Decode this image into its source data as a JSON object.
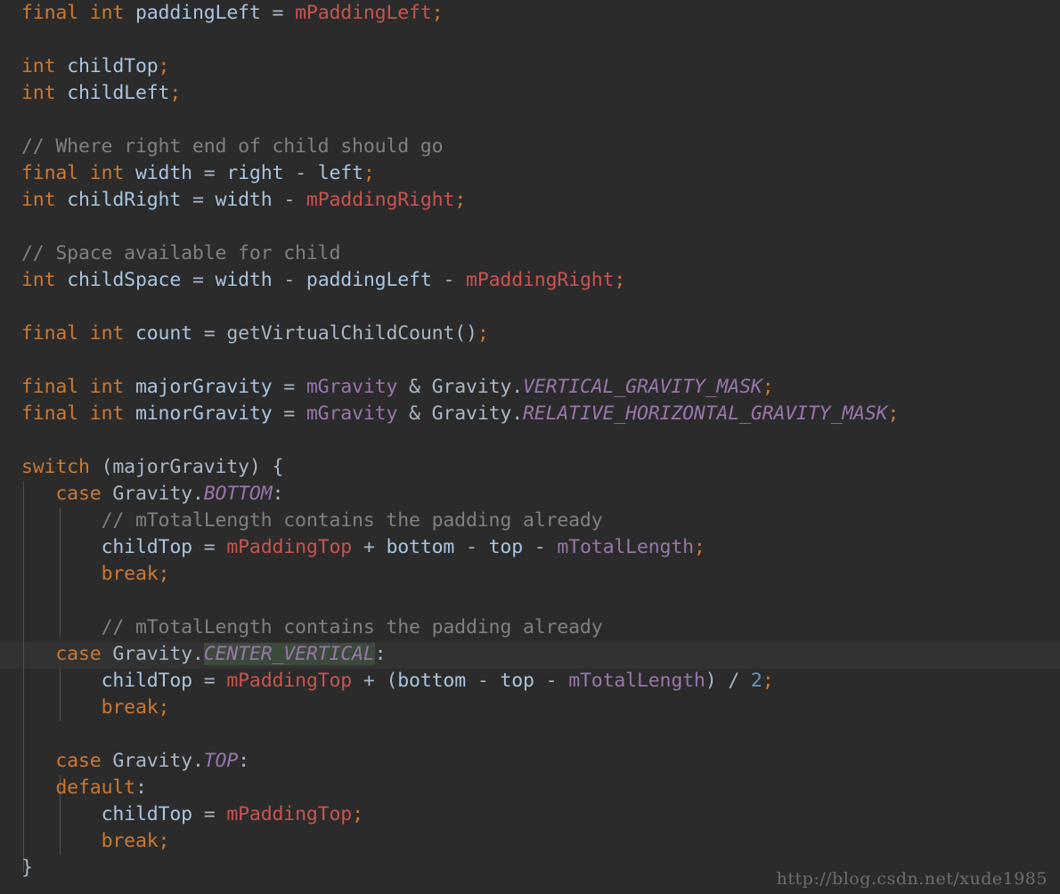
{
  "editor": {
    "language": "java",
    "theme": "darcula",
    "background_color": "#2b2b2b",
    "caret_line_color": "#323232",
    "font_size_px": 21.5,
    "line_height_px": 30,
    "caret_line_index": 24,
    "indent_guide_color": "#4f5052",
    "colors": {
      "keyword": "#cc7832",
      "identifier": "#a9b7c6",
      "local_variable": "#a9c5e0",
      "instance_field_red": "#c75450",
      "field_purple": "#9876aa",
      "static_constant": "#9876aa",
      "comment": "#808080",
      "number": "#6897bb",
      "punctuation": "#cc7832",
      "highlight_box": "#3c4a3c"
    }
  },
  "code_lines": [
    {
      "n": 1,
      "text": "final int paddingLeft = mPaddingLeft;"
    },
    {
      "n": 2,
      "text": ""
    },
    {
      "n": 3,
      "text": "int childTop;"
    },
    {
      "n": 4,
      "text": "int childLeft;"
    },
    {
      "n": 5,
      "text": ""
    },
    {
      "n": 6,
      "text": "// Where right end of child should go"
    },
    {
      "n": 7,
      "text": "final int width = right - left;"
    },
    {
      "n": 8,
      "text": "int childRight = width - mPaddingRight;"
    },
    {
      "n": 9,
      "text": ""
    },
    {
      "n": 10,
      "text": "// Space available for child"
    },
    {
      "n": 11,
      "text": "int childSpace = width - paddingLeft - mPaddingRight;"
    },
    {
      "n": 12,
      "text": ""
    },
    {
      "n": 13,
      "text": "final int count = getVirtualChildCount();"
    },
    {
      "n": 14,
      "text": ""
    },
    {
      "n": 15,
      "text": "final int majorGravity = mGravity & Gravity.VERTICAL_GRAVITY_MASK;"
    },
    {
      "n": 16,
      "text": "final int minorGravity = mGravity & Gravity.RELATIVE_HORIZONTAL_GRAVITY_MASK;"
    },
    {
      "n": 17,
      "text": ""
    },
    {
      "n": 18,
      "text": "switch (majorGravity) {"
    },
    {
      "n": 19,
      "text": "    case Gravity.BOTTOM:"
    },
    {
      "n": 20,
      "text": "        // mTotalLength contains the padding already"
    },
    {
      "n": 21,
      "text": "        childTop = mPaddingTop + bottom - top - mTotalLength;"
    },
    {
      "n": 22,
      "text": "        break;"
    },
    {
      "n": 23,
      "text": ""
    },
    {
      "n": 24,
      "text": "        // mTotalLength contains the padding already"
    },
    {
      "n": 25,
      "text": "    case Gravity.CENTER_VERTICAL:"
    },
    {
      "n": 26,
      "text": "        childTop = mPaddingTop + (bottom - top - mTotalLength) / 2;"
    },
    {
      "n": 27,
      "text": "        break;"
    },
    {
      "n": 28,
      "text": ""
    },
    {
      "n": 29,
      "text": "    case Gravity.TOP:"
    },
    {
      "n": 30,
      "text": "    default:"
    },
    {
      "n": 31,
      "text": "        childTop = mPaddingTop;"
    },
    {
      "n": 32,
      "text": "        break;"
    },
    {
      "n": 33,
      "text": "}"
    }
  ],
  "highlighted_token": "CENTER_VERTICAL",
  "watermark": {
    "text": "http://blog.csdn.net/xude1985"
  }
}
